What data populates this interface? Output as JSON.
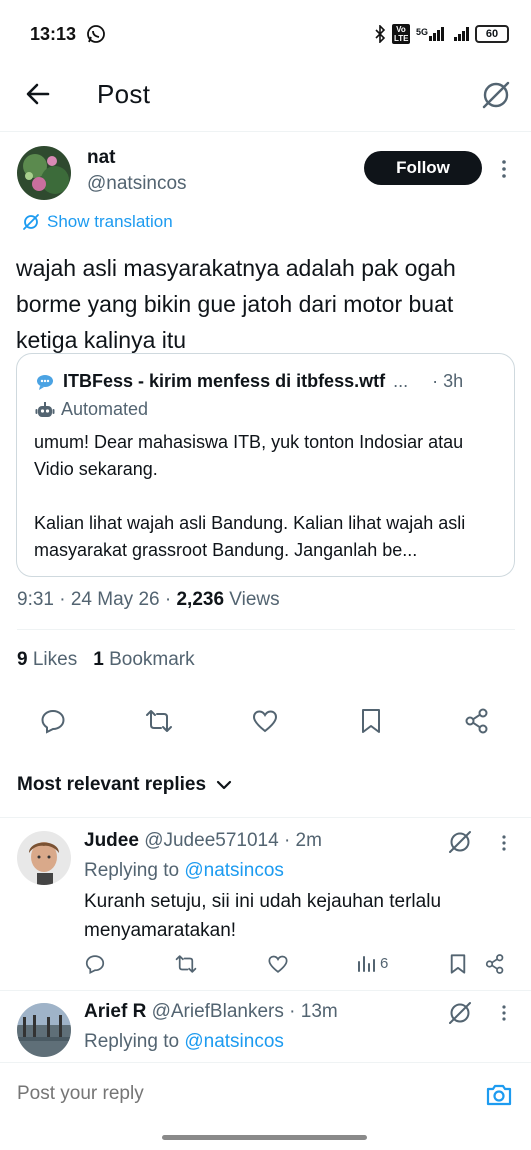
{
  "status_bar": {
    "time": "13:13",
    "network": "5G",
    "volte": "Vo LTE",
    "battery": "60"
  },
  "header": {
    "title": "Post"
  },
  "post": {
    "author": {
      "name": "nat",
      "handle": "@natsincos"
    },
    "follow_label": "Follow",
    "show_translation": "Show translation",
    "text": "wajah asli masyarakatnya adalah pak ogah borme yang bikin gue jatoh dari motor buat ketiga kalinya itu",
    "quote": {
      "name": "ITBFess - kirim menfess di itbfess.wtf",
      "ellipsis": "...",
      "time": "· 3h",
      "automated": "Automated",
      "text": "umum! Dear mahasiswa ITB, yuk tonton Indosiar atau Vidio sekarang.\n\nKalian lihat wajah asli Bandung. Kalian lihat wajah asli masyarakat grassroot Bandung. Janganlah be..."
    },
    "timestamp": "9:31 · 24 May 26 · ",
    "views_count": "2,236",
    "views_label": " Views",
    "likes_count": "9",
    "likes_label": " Likes",
    "bookmarks_count": "1",
    "bookmarks_label": " Bookmark"
  },
  "sort_label": "Most relevant replies",
  "replies": [
    {
      "name": "Judee",
      "handle": "@Judee571014",
      "time": "· 2m",
      "replying_prefix": "Replying to ",
      "replying_to": "@natsincos",
      "text": "Kuranh setuju, sii ini udah kejauhan terlalu menyamaratakan!",
      "views": "6"
    },
    {
      "name": "Arief R",
      "handle": "@AriefBlankers",
      "time": "· 13m",
      "replying_prefix": "Replying to ",
      "replying_to": "@natsincos"
    }
  ],
  "reply_bar": {
    "placeholder": "Post your reply"
  },
  "colors": {
    "accent": "#1d9bf0",
    "text": "#0f1419",
    "muted": "#536471",
    "border": "#cfd9de"
  }
}
